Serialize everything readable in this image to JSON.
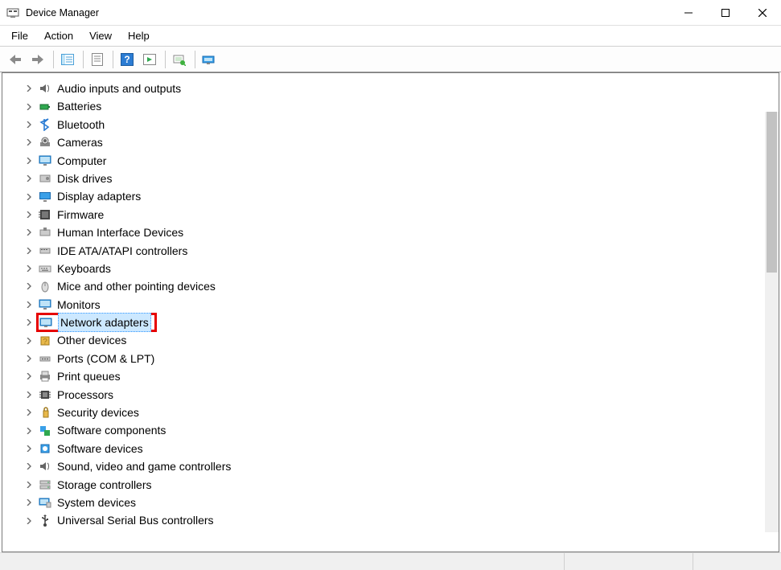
{
  "window": {
    "title": "Device Manager"
  },
  "menubar": {
    "file": "File",
    "action": "Action",
    "view": "View",
    "help": "Help"
  },
  "toolbar_icons": {
    "back": "back-arrow",
    "forward": "forward-arrow",
    "show_hide": "show-hide-console-tree",
    "properties": "properties",
    "help": "help",
    "action_ext": "action-extension",
    "scan": "scan-hardware",
    "add_legacy": "devices-and-printers"
  },
  "tree": [
    {
      "label": "Audio inputs and outputs",
      "icon": "speaker"
    },
    {
      "label": "Batteries",
      "icon": "battery"
    },
    {
      "label": "Bluetooth",
      "icon": "bluetooth"
    },
    {
      "label": "Cameras",
      "icon": "camera"
    },
    {
      "label": "Computer",
      "icon": "monitor"
    },
    {
      "label": "Disk drives",
      "icon": "disk"
    },
    {
      "label": "Display adapters",
      "icon": "display"
    },
    {
      "label": "Firmware",
      "icon": "firmware"
    },
    {
      "label": "Human Interface Devices",
      "icon": "hid"
    },
    {
      "label": "IDE ATA/ATAPI controllers",
      "icon": "ide"
    },
    {
      "label": "Keyboards",
      "icon": "keyboard"
    },
    {
      "label": "Mice and other pointing devices",
      "icon": "mouse"
    },
    {
      "label": "Monitors",
      "icon": "monitor"
    },
    {
      "label": "Network adapters",
      "icon": "network",
      "highlighted": true
    },
    {
      "label": "Other devices",
      "icon": "other"
    },
    {
      "label": "Ports (COM & LPT)",
      "icon": "port"
    },
    {
      "label": "Print queues",
      "icon": "printer"
    },
    {
      "label": "Processors",
      "icon": "cpu"
    },
    {
      "label": "Security devices",
      "icon": "security"
    },
    {
      "label": "Software components",
      "icon": "software-comp"
    },
    {
      "label": "Software devices",
      "icon": "software-dev"
    },
    {
      "label": "Sound, video and game controllers",
      "icon": "speaker"
    },
    {
      "label": "Storage controllers",
      "icon": "storage"
    },
    {
      "label": "System devices",
      "icon": "system"
    },
    {
      "label": "Universal Serial Bus controllers",
      "icon": "usb"
    }
  ]
}
